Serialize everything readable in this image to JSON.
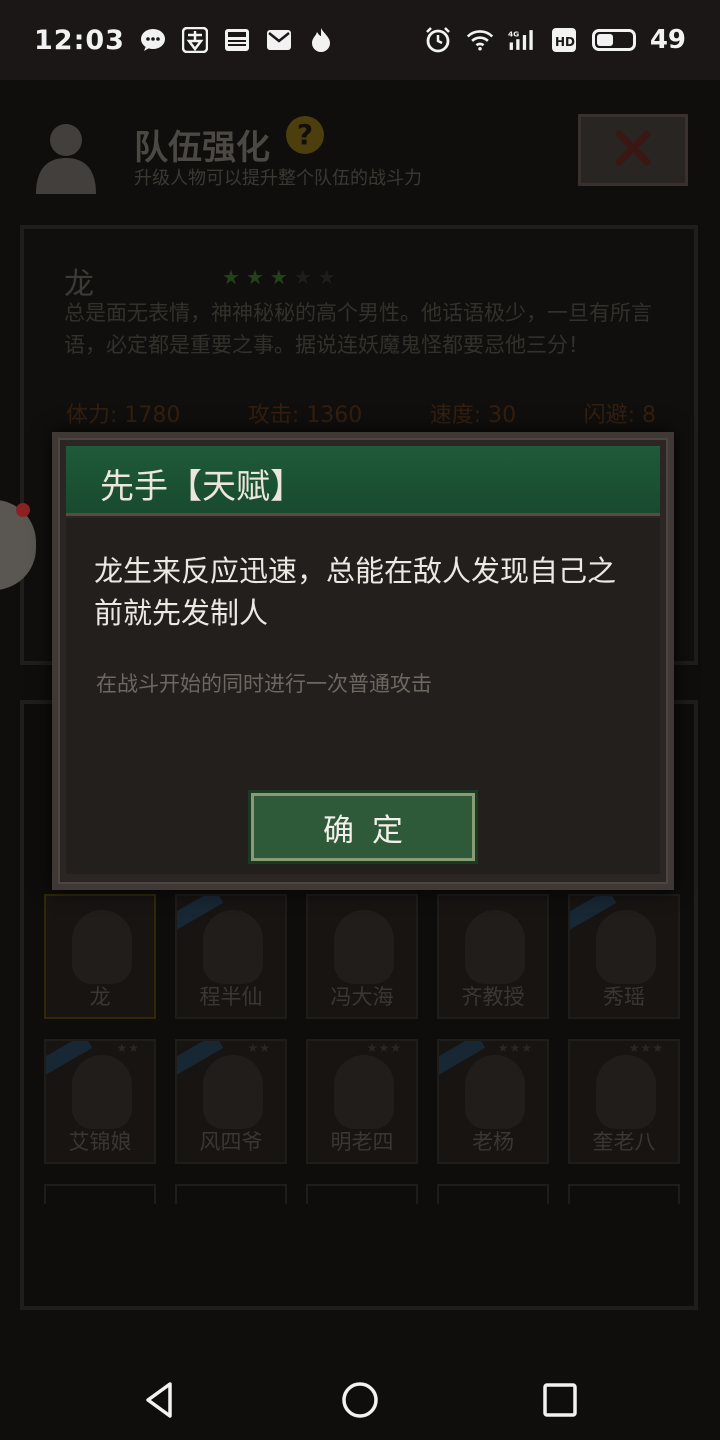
{
  "status_bar": {
    "time": "12:03",
    "left_icons": [
      "chat-bubble-icon",
      "mai-app-icon",
      "news-icon",
      "mail-icon",
      "flame-icon"
    ],
    "right_icons": [
      "alarm-icon",
      "wifi-icon",
      "signal-4g-icon",
      "hd-icon",
      "battery-icon"
    ],
    "battery_level": 49,
    "battery_text": "49"
  },
  "header": {
    "title": "队伍强化",
    "subtitle": "升级人物可以提升整个队伍的战斗力",
    "help_icon": "?"
  },
  "hero": {
    "name": "龙",
    "stars_filled": 3,
    "stars_total": 5,
    "description": "总是面无表情，神神秘秘的高个男性。他话语极少，一旦有所言语，必定都是重要之事。据说连妖魔鬼怪都要忌他三分！",
    "stats": {
      "stamina": "体力: 1780",
      "attack": "攻击: 1360",
      "speed": "速度: 30",
      "dodge": "闪避: 8"
    }
  },
  "roster": {
    "row1": [
      {
        "name": "龙",
        "selected": true,
        "tag": false
      },
      {
        "name": "程半仙",
        "selected": false,
        "tag": true
      },
      {
        "name": "冯大海",
        "selected": false,
        "tag": false
      },
      {
        "name": "齐教授",
        "selected": false,
        "tag": false
      },
      {
        "name": "秀瑶",
        "selected": false,
        "tag": true
      }
    ],
    "row2": [
      {
        "name": "艾锦娘",
        "stars": "★★",
        "tag": true
      },
      {
        "name": "风四爷",
        "stars": "★★",
        "tag": true
      },
      {
        "name": "明老四",
        "stars": "★★★",
        "tag": false
      },
      {
        "name": "老杨",
        "stars": "★★★",
        "tag": true
      },
      {
        "name": "奎老八",
        "stars": "★★★",
        "tag": false
      }
    ]
  },
  "modal": {
    "title": "先手【天赋】",
    "talent_description": "龙生来反应迅速，总能在敌人发现自己之前就先发制人",
    "talent_effect": "在战斗开始的同时进行一次普通攻击",
    "confirm_label": "确定"
  },
  "nav_bar": {
    "icons": [
      "back-triangle-icon",
      "home-circle-icon",
      "recents-square-icon"
    ]
  },
  "colors": {
    "modal_header": "#1f5a3a",
    "confirm_button": "#2f5a3a",
    "star_green": "#3f7a2e",
    "stat_brown": "#5c3a1c"
  }
}
